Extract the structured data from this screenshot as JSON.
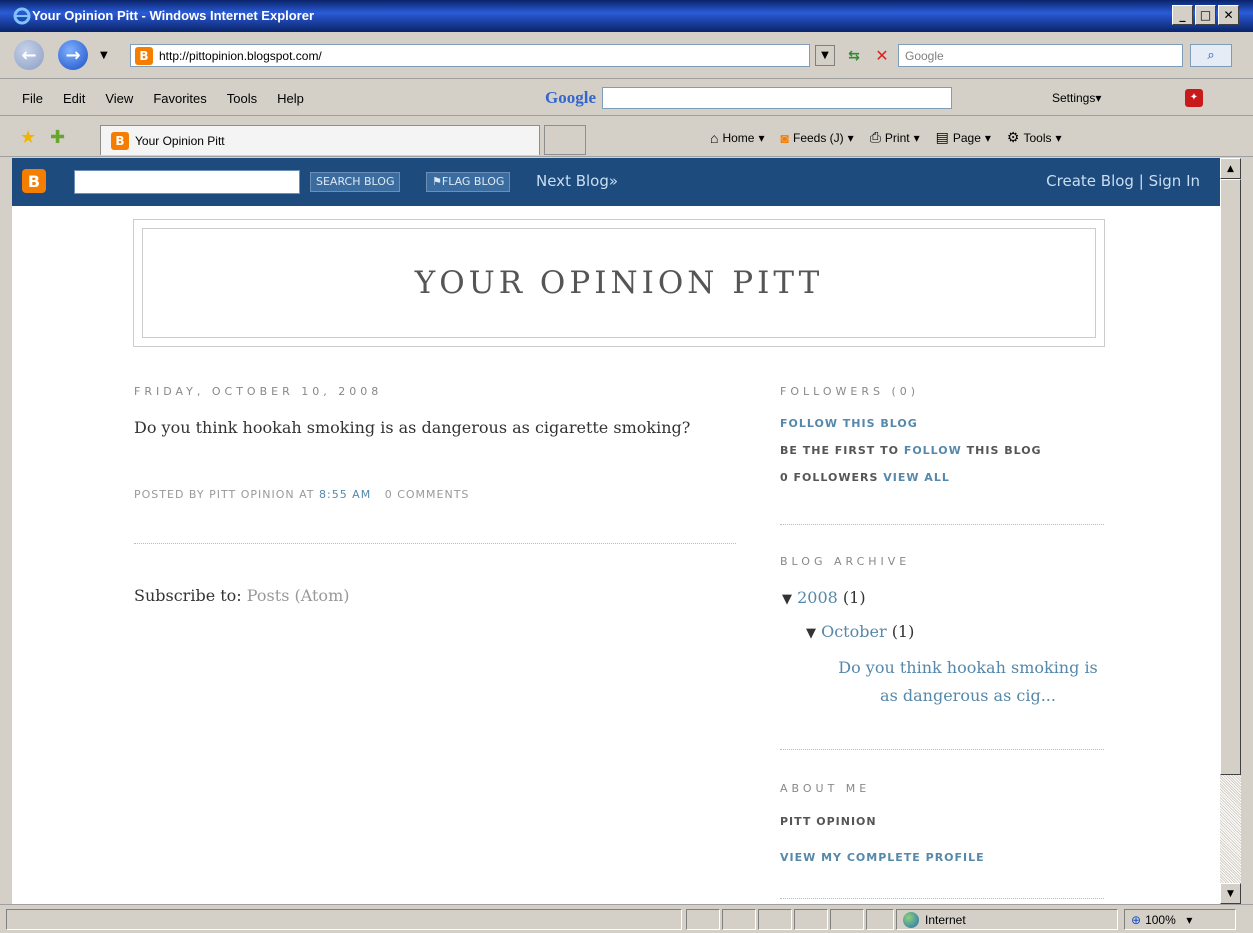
{
  "window": {
    "title": "Your Opinion Pitt - Windows Internet Explorer",
    "min": "_",
    "max": "□",
    "close": "✕"
  },
  "address": {
    "url": "http://pittopinion.blogspot.com/",
    "search_placeholder": "Google"
  },
  "menu": {
    "items": [
      "File",
      "Edit",
      "View",
      "Favorites",
      "Tools",
      "Help"
    ]
  },
  "google_toolbar": {
    "logo": "Google",
    "settings": "Settings▾"
  },
  "tab": {
    "label": "Your Opinion Pitt"
  },
  "command_bar": {
    "home": "Home",
    "feeds": "Feeds (J)",
    "print": "Print",
    "page": "Page",
    "tools": "Tools"
  },
  "blogger_nav": {
    "search_blog": "SEARCH BLOG",
    "flag_blog": "FLAG BLOG",
    "next_blog": "Next Blog»",
    "create_blog": "Create Blog",
    "separator": "|",
    "sign_in": "Sign In"
  },
  "blog": {
    "title": "YOUR OPINION PITT",
    "post": {
      "date": "FRIDAY, OCTOBER 10, 2008",
      "title": "Do you think hookah smoking is as dangerous as cigarette smoking?",
      "posted_by": "POSTED BY PITT OPINION AT",
      "time": "8:55 AM",
      "comments": "0 COMMENTS"
    },
    "subscribe_label": "Subscribe to:",
    "subscribe_link": "Posts (Atom)"
  },
  "sidebar": {
    "followers_heading": "FOLLOWERS (0)",
    "follow_link": "FOLLOW THIS BLOG",
    "be_first_prefix": "BE THE FIRST TO",
    "be_first_link": "FOLLOW",
    "be_first_suffix": "THIS BLOG",
    "followers_count": "0 FOLLOWERS",
    "view_all": "VIEW ALL",
    "archive_heading": "BLOG ARCHIVE",
    "archive_year": "2008",
    "archive_year_count": "(1)",
    "archive_month": "October",
    "archive_month_count": "(1)",
    "archive_post": "Do you think hookah smoking is as dangerous as cig...",
    "about_heading": "ABOUT ME",
    "about_name": "PITT OPINION",
    "view_profile": "VIEW MY COMPLETE PROFILE"
  },
  "status": {
    "zone": "Internet",
    "zoom": "100%"
  }
}
